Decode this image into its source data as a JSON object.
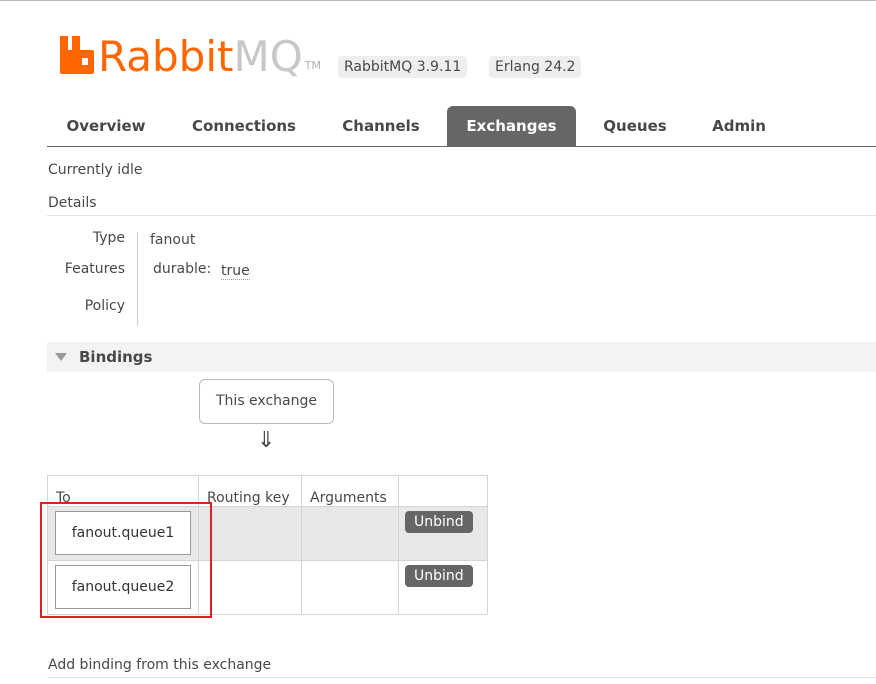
{
  "header": {
    "logo_rabbit": "Rabbit",
    "logo_mq": "MQ",
    "logo_tm": "TM",
    "rabbitmq_version": "RabbitMQ 3.9.11",
    "erlang_version": "Erlang 24.2",
    "brand_color": "#ff6600"
  },
  "tabs": [
    {
      "label": "Overview"
    },
    {
      "label": "Connections"
    },
    {
      "label": "Channels"
    },
    {
      "label": "Exchanges",
      "active": true
    },
    {
      "label": "Queues"
    },
    {
      "label": "Admin"
    }
  ],
  "status_text": "Currently idle",
  "details": {
    "heading": "Details",
    "type_label": "Type",
    "type_value": "fanout",
    "features_label": "Features",
    "durable_key": "durable:",
    "durable_value": "true",
    "policy_label": "Policy"
  },
  "bindings": {
    "title": "Bindings",
    "source_box": "This exchange",
    "arrow": "⇓",
    "columns": [
      "To",
      "Routing key",
      "Arguments",
      ""
    ],
    "rows": [
      {
        "to": "fanout.queue1",
        "routing_key": "",
        "arguments": "",
        "action": "Unbind"
      },
      {
        "to": "fanout.queue2",
        "routing_key": "",
        "arguments": "",
        "action": "Unbind"
      }
    ]
  },
  "add_binding_label": "Add binding from this exchange"
}
